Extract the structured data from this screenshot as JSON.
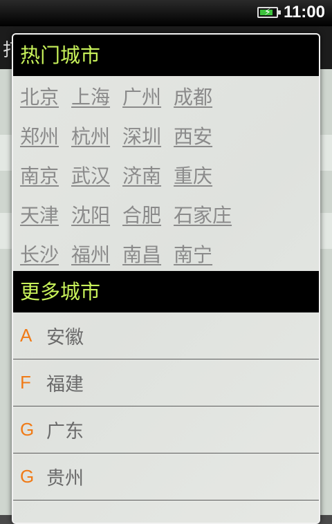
{
  "status_bar": {
    "time": "11:00",
    "battery_icon": "battery-charging-icon"
  },
  "background": {
    "header_char": "打"
  },
  "dialog": {
    "hot_title": "热门城市",
    "hot_cities": [
      [
        "北京",
        "上海",
        "广州",
        "成都"
      ],
      [
        "郑州",
        "杭州",
        "深圳",
        "西安"
      ],
      [
        "南京",
        "武汉",
        "济南",
        "重庆"
      ],
      [
        "天津",
        "沈阳",
        "合肥",
        "石家庄"
      ],
      [
        "长沙",
        "福州",
        "南昌",
        "南宁"
      ]
    ],
    "more_title": "更多城市",
    "provinces": [
      {
        "letter": "A",
        "name": "安徽"
      },
      {
        "letter": "F",
        "name": "福建"
      },
      {
        "letter": "G",
        "name": "广东"
      },
      {
        "letter": "G",
        "name": "贵州"
      }
    ]
  },
  "colors": {
    "header_text": "#c8f25a",
    "letter": "#f07a16",
    "city_text": "#8a8a8a"
  }
}
